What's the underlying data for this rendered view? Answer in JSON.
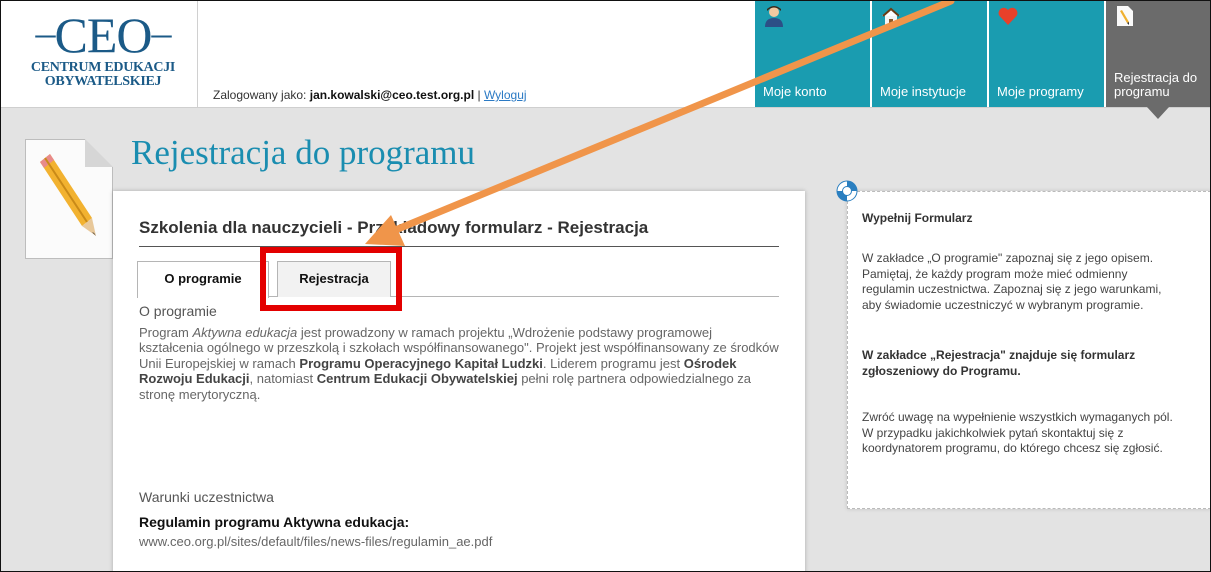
{
  "logo": {
    "mark": "CEO",
    "line1": "CENTRUM EDUKACJI",
    "line2": "OBYWATELSKIEJ"
  },
  "login": {
    "prefix": "Zalogowany jako: ",
    "user": "jan.kowalski@ceo.test.org.pl",
    "separator": " | ",
    "logout": "Wyloguj"
  },
  "nav": {
    "items": [
      {
        "label": "Moje konto",
        "icon": "user-icon"
      },
      {
        "label": "Moje instytucje",
        "icon": "house-icon"
      },
      {
        "label": "Moje programy",
        "icon": "heart-icon"
      },
      {
        "label": "Rejestracja do programu",
        "icon": "document-pencil-icon",
        "active": true
      }
    ]
  },
  "page": {
    "title": "Rejestracja do programu",
    "icon": "pencil-document-icon"
  },
  "form": {
    "title": "Szkolenia dla nauczycieli - Przykładowy formularz - Rejestracja",
    "tabs": [
      {
        "label": "O programie",
        "selected": true
      },
      {
        "label": "Rejestracja",
        "selected": false
      }
    ],
    "about": {
      "heading": "O programie",
      "t1": "Program ",
      "t2": "Aktywna edukacja",
      "t3": " jest prowadzony w ramach projektu „Wdrożenie podstawy programowej kształcenia ogólnego w przeszkolą i szkołach współfinansowanego\". Projekt jest współfinansowany ze środków Unii Europejskiej w ramach ",
      "t4": "Programu Operacyjnego Kapitał Ludzki",
      "t5": ". Liderem programu jest ",
      "t6": "Ośrodek Rozwoju Edukacji",
      "t7": ", natomiast ",
      "t8": "Centrum Edukacji Obywatelskiej",
      "t9": " pełni rolę partnera odpowiedzialnego za stronę merytoryczną."
    },
    "conditions": {
      "heading": "Warunki uczestnictwa",
      "reg_title": "Regulamin programu Aktywna edukacja:",
      "reg_url": "www.ceo.org.pl/sites/default/files/news-files/regulamin_ae.pdf"
    }
  },
  "info": {
    "icon": "lifebuoy-icon",
    "title": "Wypełnij Formularz",
    "p1": "W zakładce „O programie\" zapoznaj się z jego opisem. Pamiętaj, że każdy program może mieć odmienny regulamin uczestnictwa. Zapoznaj się z jego warunkami, aby świadomie uczestniczyć w wybranym programie.",
    "p2": "W zakładce „Rejestracja\" znajduje się formularz zgłoszeniowy do Programu.",
    "p3": "Zwróć uwagę na wypełnienie wszystkich wymaganych pól. W przypadku jakichkolwiek pytań skontaktuj się z koordynatorem programu, do którego chcesz się zgłosić."
  },
  "colors": {
    "teal": "#1a9cb0",
    "active": "#6b6b6b",
    "title": "#1a8db0",
    "highlight": "#e30000",
    "arrow": "#f0954a"
  }
}
